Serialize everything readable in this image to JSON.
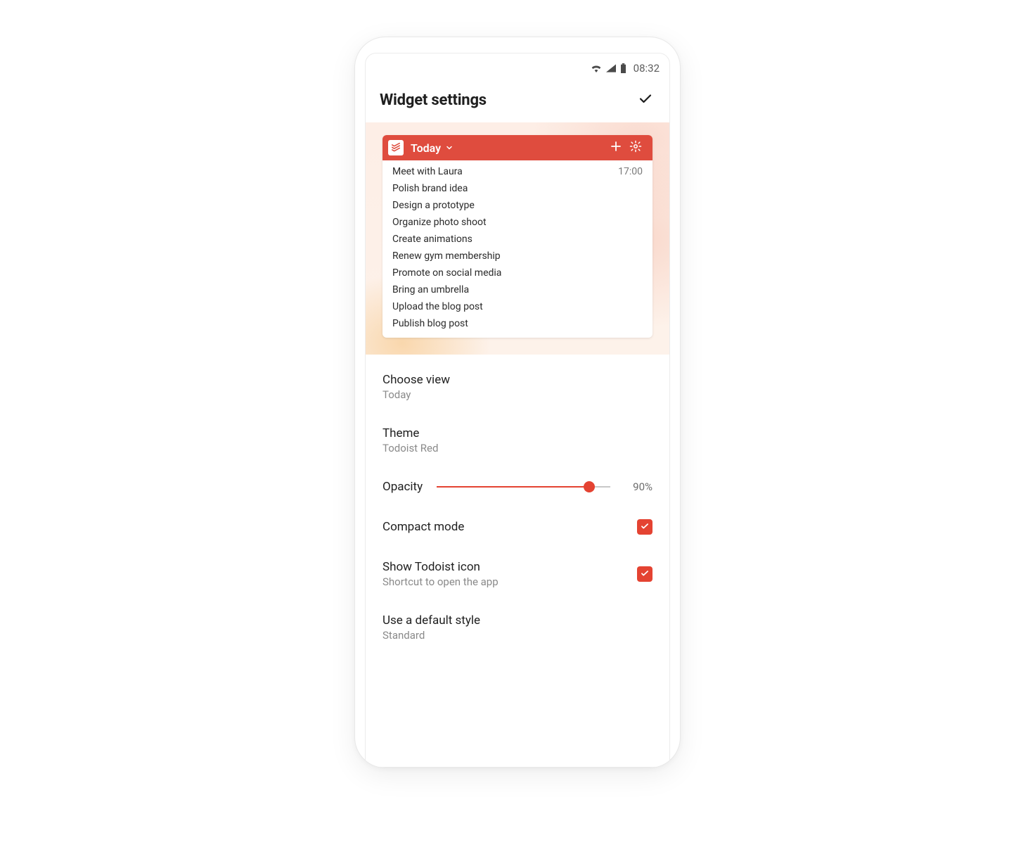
{
  "statusbar": {
    "time": "08:32"
  },
  "titlebar": {
    "title": "Widget settings"
  },
  "widget": {
    "view_label": "Today",
    "tasks": [
      {
        "title": "Meet with Laura",
        "time": "17:00"
      },
      {
        "title": "Polish brand idea",
        "time": ""
      },
      {
        "title": "Design a prototype",
        "time": ""
      },
      {
        "title": "Organize photo shoot",
        "time": ""
      },
      {
        "title": "Create animations",
        "time": ""
      },
      {
        "title": "Renew gym membership",
        "time": ""
      },
      {
        "title": "Promote on social media",
        "time": ""
      },
      {
        "title": "Bring an umbrella",
        "time": ""
      },
      {
        "title": "Upload the blog post",
        "time": ""
      },
      {
        "title": "Publish blog post",
        "time": ""
      }
    ]
  },
  "settings": {
    "choose_view": {
      "label": "Choose view",
      "value": "Today"
    },
    "theme": {
      "label": "Theme",
      "value": "Todoist Red"
    },
    "opacity": {
      "label": "Opacity",
      "value_text": "90%",
      "percent": 90
    },
    "compact": {
      "label": "Compact mode",
      "checked": true
    },
    "show_icon": {
      "label": "Show Todoist icon",
      "sub": "Shortcut to open the app",
      "checked": true
    },
    "default_style": {
      "label": "Use a default style",
      "value": "Standard"
    }
  },
  "colors": {
    "accent": "#e44332",
    "header": "#df4c3e"
  }
}
